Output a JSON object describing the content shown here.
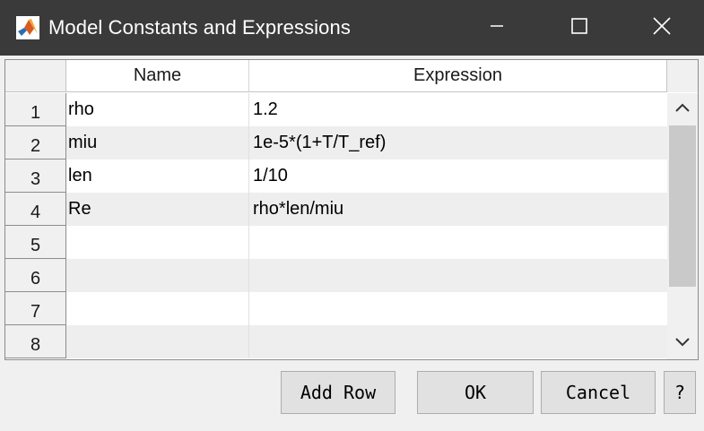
{
  "window": {
    "title": "Model Constants and Expressions",
    "app_icon": "matlab-icon",
    "controls": [
      "minimize-icon",
      "maximize-icon",
      "close-icon"
    ]
  },
  "table": {
    "columns": [
      "Name",
      "Expression"
    ],
    "rows": [
      {
        "num": "1",
        "name": "rho",
        "expression": "1.2"
      },
      {
        "num": "2",
        "name": "miu",
        "expression": "1e-5*(1+T/T_ref)"
      },
      {
        "num": "3",
        "name": "len",
        "expression": "1/10"
      },
      {
        "num": "4",
        "name": "Re",
        "expression": "rho*len/miu"
      },
      {
        "num": "5",
        "name": "",
        "expression": ""
      },
      {
        "num": "6",
        "name": "",
        "expression": ""
      },
      {
        "num": "7",
        "name": "",
        "expression": ""
      },
      {
        "num": "8",
        "name": "",
        "expression": ""
      }
    ]
  },
  "buttons": {
    "add_row": "Add Row",
    "ok": "OK",
    "cancel": "Cancel",
    "help": "?"
  }
}
